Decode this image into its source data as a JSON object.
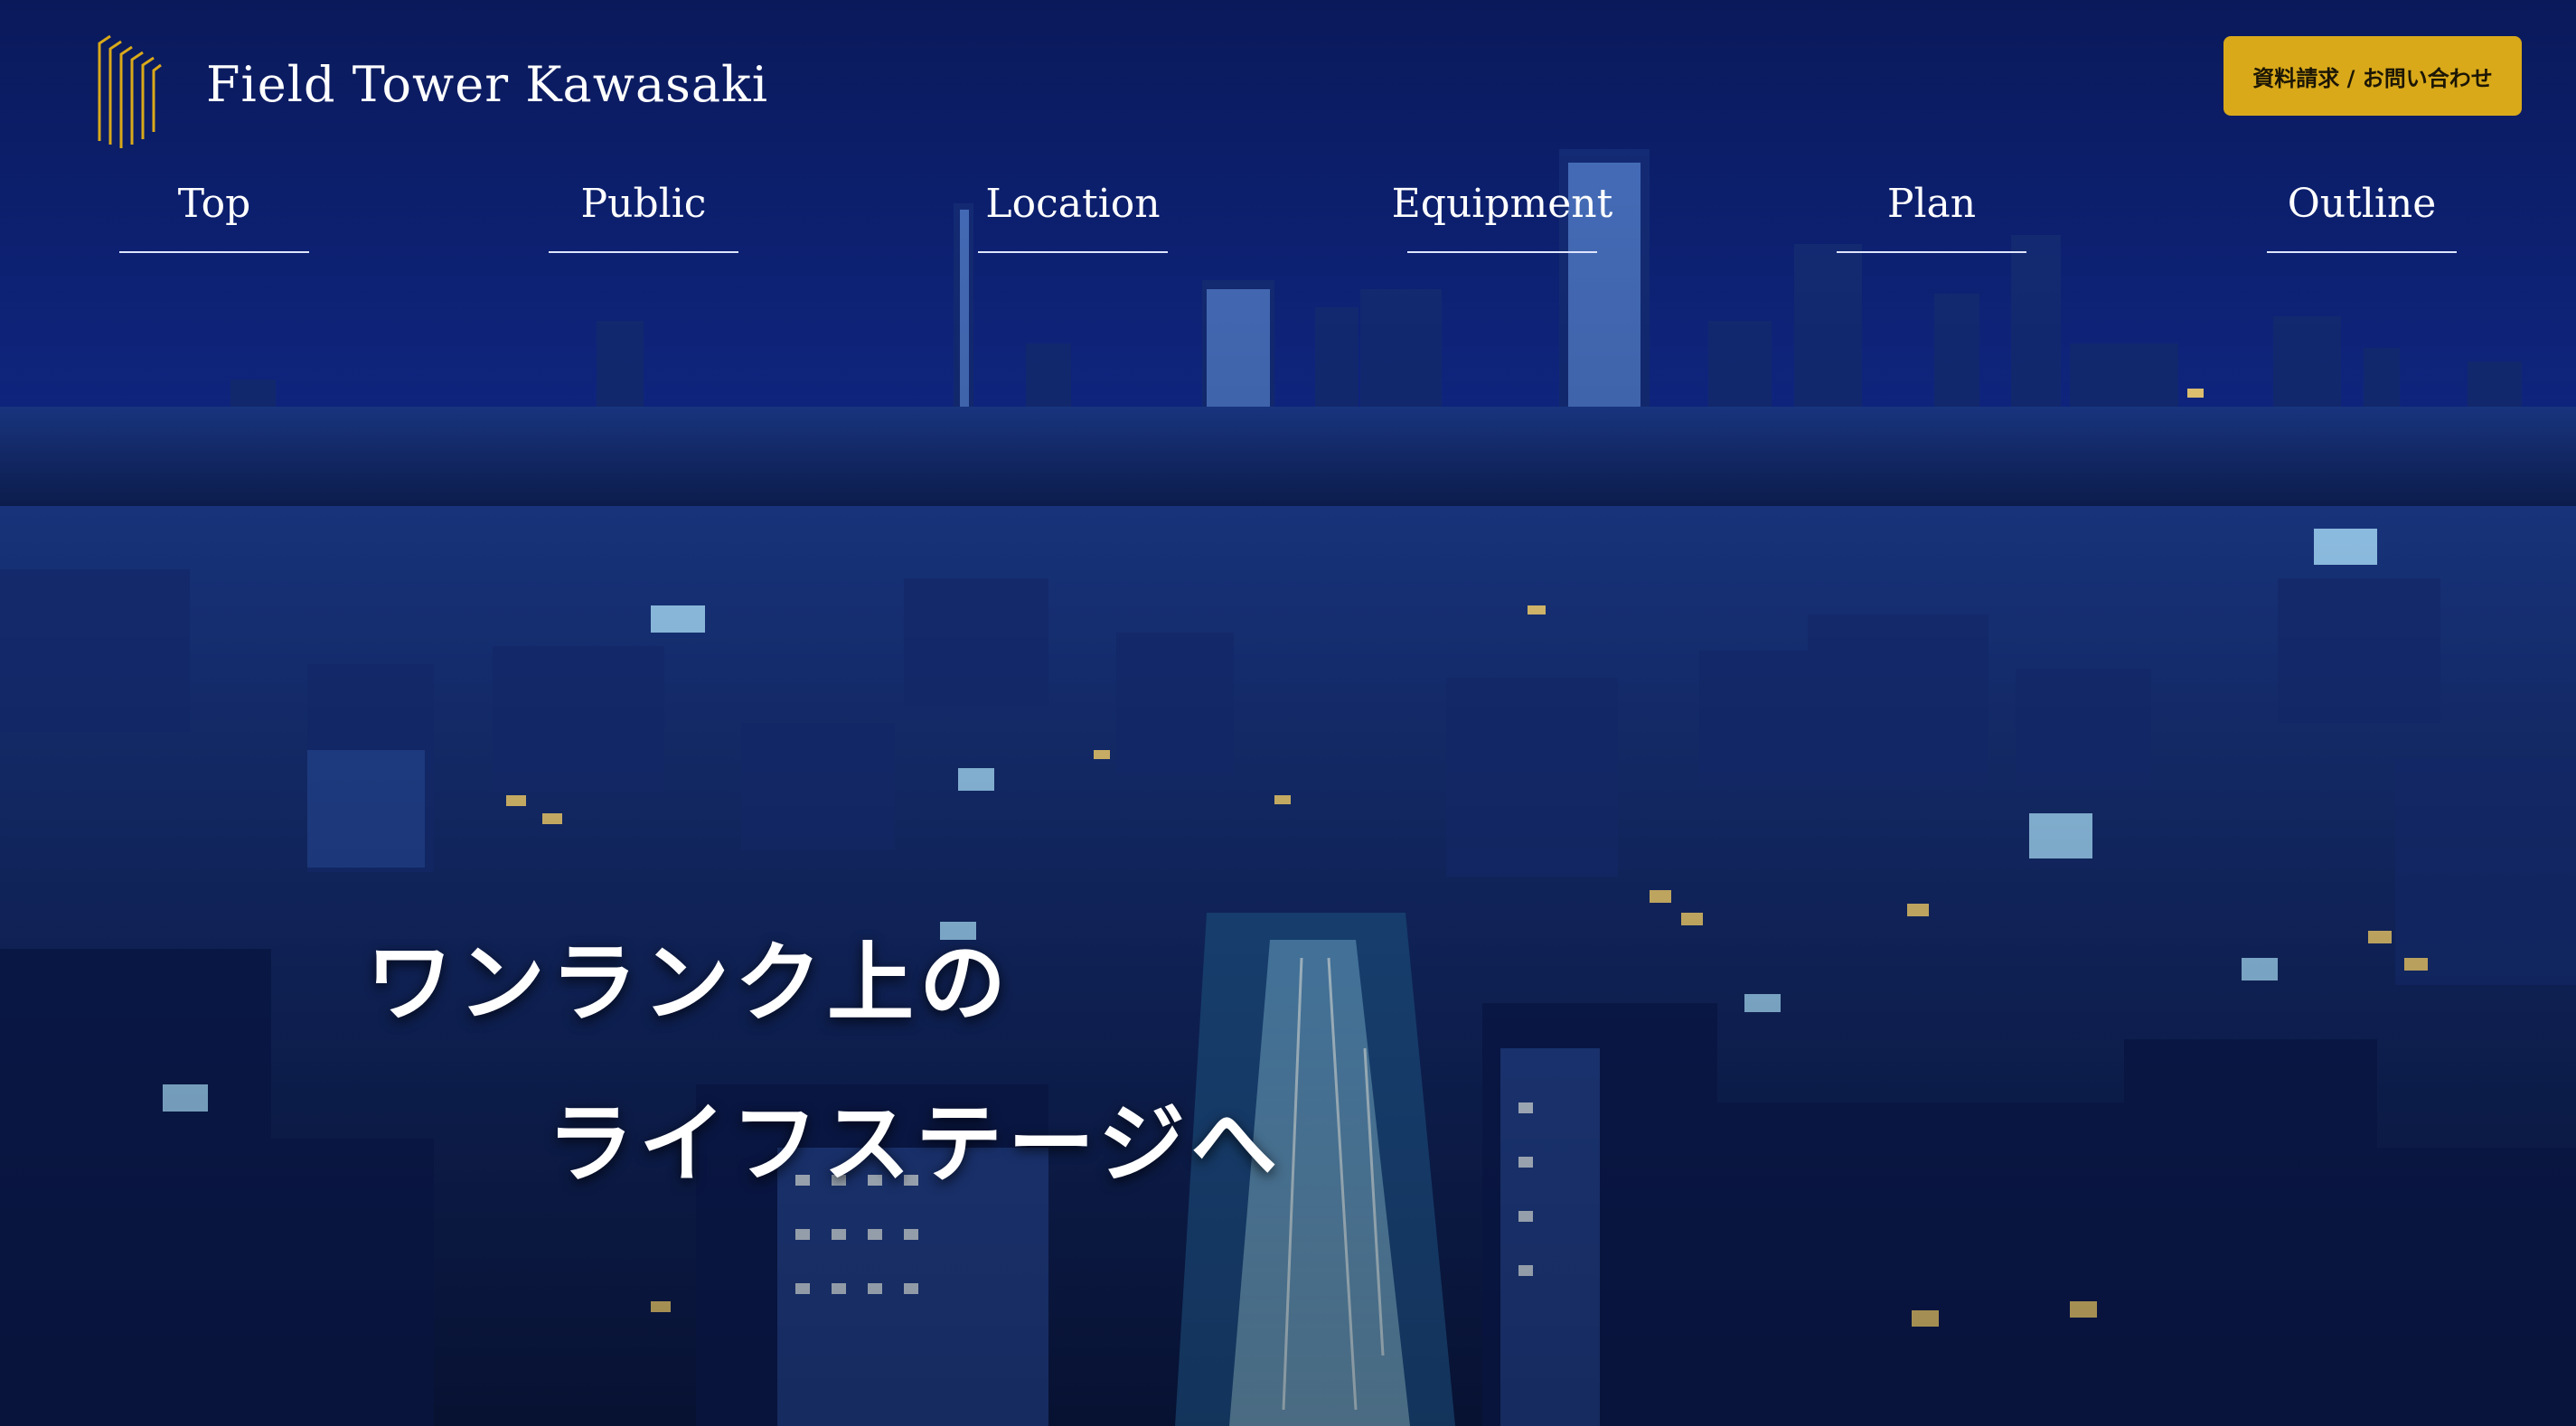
{
  "site": {
    "brand_name": "Field Tower Kawasaki",
    "logo_icon": "gold-vertical-lines-logo-icon"
  },
  "header": {
    "cta_label": "資料請求 / お問い合わせ",
    "cta_color": "#d9a91a"
  },
  "nav": {
    "items": [
      {
        "label": "Top"
      },
      {
        "label": "Public"
      },
      {
        "label": "Location"
      },
      {
        "label": "Equipment"
      },
      {
        "label": "Plan"
      },
      {
        "label": "Outline"
      }
    ]
  },
  "hero": {
    "headline_line1": "ワンランク上の",
    "headline_line2": "ライフステージへ",
    "background": "night-city-skyline-photo",
    "accent_color": "#d9a91a",
    "sky_color": "#0d2478"
  }
}
